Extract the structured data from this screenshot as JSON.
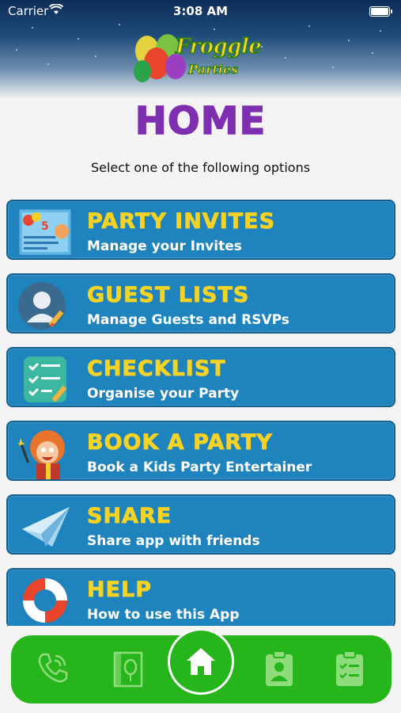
{
  "status": {
    "carrier": "Carrier",
    "time": "3:08 AM"
  },
  "logo": {
    "name": "Froggle",
    "sub": "Parties"
  },
  "page": {
    "title": "HOME",
    "subtitle": "Select one of the following options"
  },
  "menu": [
    {
      "title": "PARTY INVITES",
      "subtitle": "Manage your Invites",
      "icon": "invite-card-icon"
    },
    {
      "title": "GUEST LISTS",
      "subtitle": "Manage Guests and RSVPs",
      "icon": "guest-avatar-icon"
    },
    {
      "title": "CHECKLIST",
      "subtitle": "Organise your Party",
      "icon": "checklist-icon"
    },
    {
      "title": "BOOK A PARTY",
      "subtitle": "Book a Kids Party Entertainer",
      "icon": "entertainer-icon"
    },
    {
      "title": "SHARE",
      "subtitle": "Share app with friends",
      "icon": "paper-plane-icon"
    },
    {
      "title": "HELP",
      "subtitle": "How to use this App",
      "icon": "lifebuoy-icon"
    }
  ],
  "tabs": [
    "phone-icon",
    "invite-icon",
    "home-icon",
    "guest-badge-icon",
    "checklist-clipboard-icon"
  ],
  "colors": {
    "card": "#1f84bd",
    "title": "#7d2fb0",
    "card_title": "#f5d324",
    "tabbar": "#27b51c"
  }
}
